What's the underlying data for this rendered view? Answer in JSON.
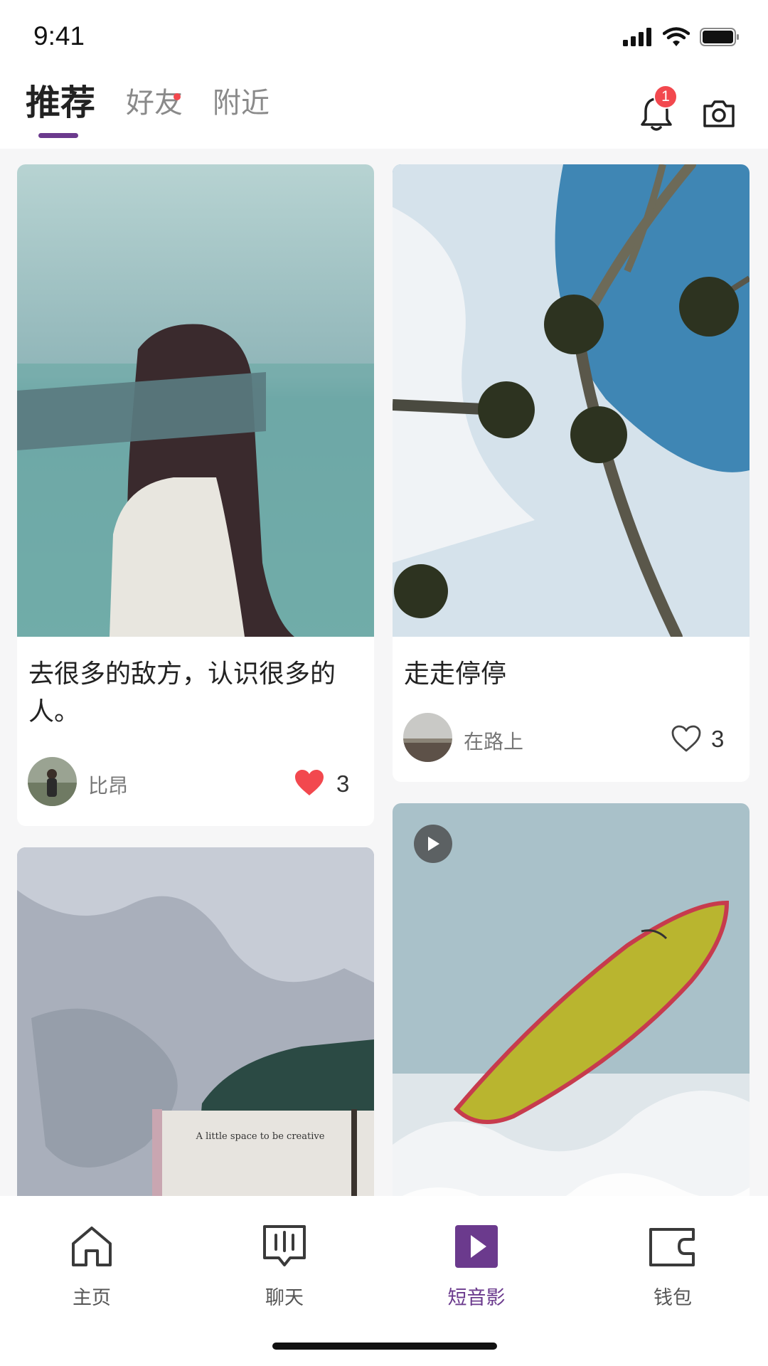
{
  "status_bar": {
    "time": "9:41",
    "icons": [
      "signal-icon",
      "wifi-icon",
      "battery-icon"
    ]
  },
  "header": {
    "tabs": [
      {
        "label": "推荐",
        "active": true
      },
      {
        "label": "好友",
        "active": false,
        "has_dot": true
      },
      {
        "label": "附近",
        "active": false
      }
    ],
    "notification_count": "1",
    "icons": [
      "bell-icon",
      "camera-icon"
    ]
  },
  "feed": {
    "cards": [
      {
        "image": "blindfolded-woman-photo",
        "title": "去很多的敌方，认识很多的人。",
        "author": "比昂",
        "likes": "3",
        "liked": true
      },
      {
        "image": "palm-trees-photo",
        "title": "走走停停",
        "author": "在路上",
        "likes": "3",
        "liked": false
      },
      {
        "image": "book-on-sheets-photo",
        "image_text": "A little space to be creative"
      },
      {
        "image": "surfboard-wave-photo",
        "is_video": true
      }
    ]
  },
  "bottom_nav": {
    "items": [
      {
        "label": "主页",
        "icon": "home-icon",
        "active": false
      },
      {
        "label": "聊天",
        "icon": "chat-icon",
        "active": false
      },
      {
        "label": "短音影",
        "icon": "video-play-icon",
        "active": true
      },
      {
        "label": "钱包",
        "icon": "wallet-icon",
        "active": false
      }
    ]
  },
  "colors": {
    "accent": "#6b3a8d",
    "badge": "#f2484e",
    "like": "#f2484e",
    "background": "#f6f6f7"
  }
}
